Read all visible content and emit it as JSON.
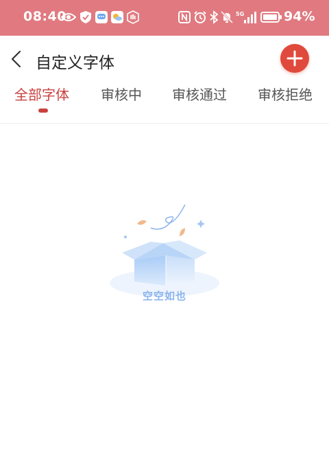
{
  "status_bar": {
    "time": "08:40",
    "battery_percent": "94%",
    "signal_label": "5G",
    "icons": [
      "eye-icon",
      "shield-icon",
      "message-icon",
      "weather-icon",
      "hand-icon",
      "nfc-icon",
      "alarm-icon",
      "bluetooth-icon",
      "mute-icon",
      "signal-icon",
      "battery-icon"
    ]
  },
  "header": {
    "title": "自定义字体",
    "back_icon": "chevron-left-icon",
    "add_icon": "plus-icon"
  },
  "tabs": [
    {
      "label": "全部字体",
      "active": true
    },
    {
      "label": "审核中",
      "active": false
    },
    {
      "label": "审核通过",
      "active": false
    },
    {
      "label": "审核拒绝",
      "active": false
    }
  ],
  "empty_state": {
    "text": "空空如也",
    "icon": "empty-box-icon"
  },
  "colors": {
    "status_bar": "#e07a80",
    "accent": "#c9413f",
    "add_button": "#e04a3c",
    "empty_text": "#8cb4ee"
  }
}
